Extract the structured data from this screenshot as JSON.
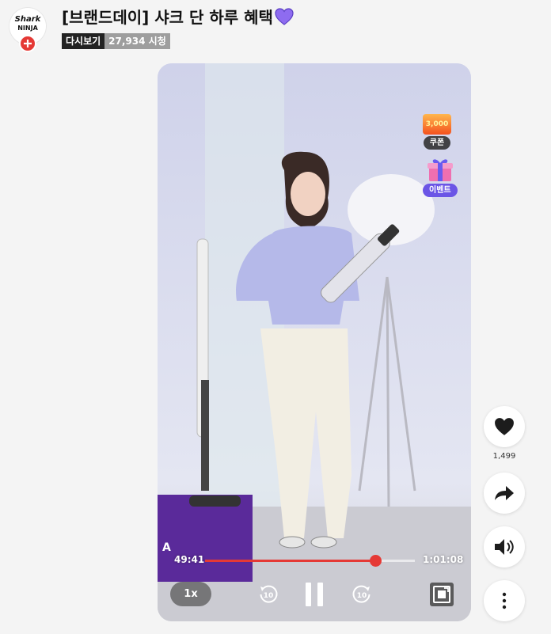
{
  "channel": {
    "logo_line1": "Shark",
    "logo_line2": "NINJA"
  },
  "header": {
    "title": "[브랜드데이] 샤크 단 하루 혜택",
    "badge_replay": "다시보기",
    "views": "27,934 시청"
  },
  "video": {
    "coupon_amount": "3,000",
    "coupon_label": "쿠폰",
    "event_label": "이벤트",
    "current_time": "49:41",
    "duration": "1:01:08",
    "progress": 0.8127,
    "speed": "1x",
    "rewind_seconds": "10",
    "forward_seconds": "10",
    "brand_box_text": "A"
  },
  "actions": {
    "like_count": "1,499"
  },
  "colors": {
    "accent_red": "#e53935",
    "heart_purple": "#8e6cf0",
    "event_purple": "#6b55e6"
  }
}
